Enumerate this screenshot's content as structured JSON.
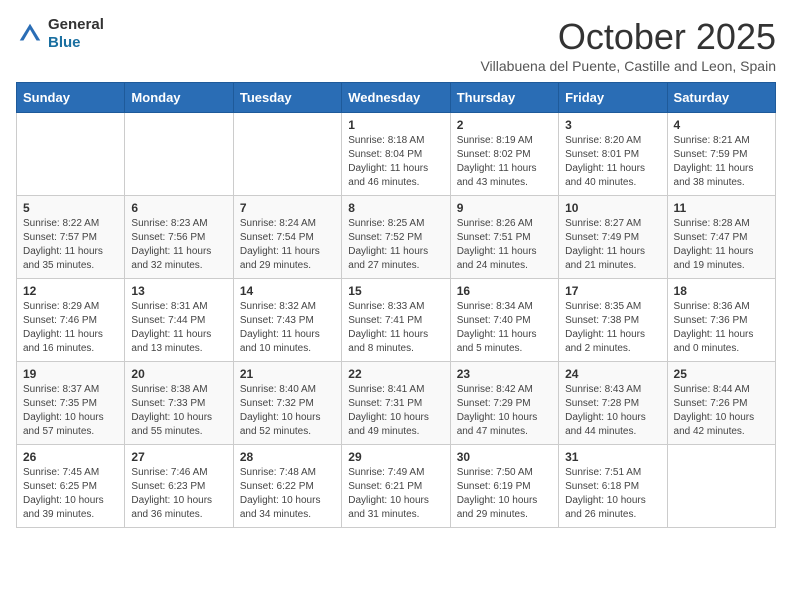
{
  "header": {
    "logo_general": "General",
    "logo_blue": "Blue",
    "month_title": "October 2025",
    "subtitle": "Villabuena del Puente, Castille and Leon, Spain"
  },
  "weekdays": [
    "Sunday",
    "Monday",
    "Tuesday",
    "Wednesday",
    "Thursday",
    "Friday",
    "Saturday"
  ],
  "weeks": [
    [
      {
        "day": "",
        "sunrise": "",
        "sunset": "",
        "daylight": ""
      },
      {
        "day": "",
        "sunrise": "",
        "sunset": "",
        "daylight": ""
      },
      {
        "day": "",
        "sunrise": "",
        "sunset": "",
        "daylight": ""
      },
      {
        "day": "1",
        "sunrise": "Sunrise: 8:18 AM",
        "sunset": "Sunset: 8:04 PM",
        "daylight": "Daylight: 11 hours and 46 minutes."
      },
      {
        "day": "2",
        "sunrise": "Sunrise: 8:19 AM",
        "sunset": "Sunset: 8:02 PM",
        "daylight": "Daylight: 11 hours and 43 minutes."
      },
      {
        "day": "3",
        "sunrise": "Sunrise: 8:20 AM",
        "sunset": "Sunset: 8:01 PM",
        "daylight": "Daylight: 11 hours and 40 minutes."
      },
      {
        "day": "4",
        "sunrise": "Sunrise: 8:21 AM",
        "sunset": "Sunset: 7:59 PM",
        "daylight": "Daylight: 11 hours and 38 minutes."
      }
    ],
    [
      {
        "day": "5",
        "sunrise": "Sunrise: 8:22 AM",
        "sunset": "Sunset: 7:57 PM",
        "daylight": "Daylight: 11 hours and 35 minutes."
      },
      {
        "day": "6",
        "sunrise": "Sunrise: 8:23 AM",
        "sunset": "Sunset: 7:56 PM",
        "daylight": "Daylight: 11 hours and 32 minutes."
      },
      {
        "day": "7",
        "sunrise": "Sunrise: 8:24 AM",
        "sunset": "Sunset: 7:54 PM",
        "daylight": "Daylight: 11 hours and 29 minutes."
      },
      {
        "day": "8",
        "sunrise": "Sunrise: 8:25 AM",
        "sunset": "Sunset: 7:52 PM",
        "daylight": "Daylight: 11 hours and 27 minutes."
      },
      {
        "day": "9",
        "sunrise": "Sunrise: 8:26 AM",
        "sunset": "Sunset: 7:51 PM",
        "daylight": "Daylight: 11 hours and 24 minutes."
      },
      {
        "day": "10",
        "sunrise": "Sunrise: 8:27 AM",
        "sunset": "Sunset: 7:49 PM",
        "daylight": "Daylight: 11 hours and 21 minutes."
      },
      {
        "day": "11",
        "sunrise": "Sunrise: 8:28 AM",
        "sunset": "Sunset: 7:47 PM",
        "daylight": "Daylight: 11 hours and 19 minutes."
      }
    ],
    [
      {
        "day": "12",
        "sunrise": "Sunrise: 8:29 AM",
        "sunset": "Sunset: 7:46 PM",
        "daylight": "Daylight: 11 hours and 16 minutes."
      },
      {
        "day": "13",
        "sunrise": "Sunrise: 8:31 AM",
        "sunset": "Sunset: 7:44 PM",
        "daylight": "Daylight: 11 hours and 13 minutes."
      },
      {
        "day": "14",
        "sunrise": "Sunrise: 8:32 AM",
        "sunset": "Sunset: 7:43 PM",
        "daylight": "Daylight: 11 hours and 10 minutes."
      },
      {
        "day": "15",
        "sunrise": "Sunrise: 8:33 AM",
        "sunset": "Sunset: 7:41 PM",
        "daylight": "Daylight: 11 hours and 8 minutes."
      },
      {
        "day": "16",
        "sunrise": "Sunrise: 8:34 AM",
        "sunset": "Sunset: 7:40 PM",
        "daylight": "Daylight: 11 hours and 5 minutes."
      },
      {
        "day": "17",
        "sunrise": "Sunrise: 8:35 AM",
        "sunset": "Sunset: 7:38 PM",
        "daylight": "Daylight: 11 hours and 2 minutes."
      },
      {
        "day": "18",
        "sunrise": "Sunrise: 8:36 AM",
        "sunset": "Sunset: 7:36 PM",
        "daylight": "Daylight: 11 hours and 0 minutes."
      }
    ],
    [
      {
        "day": "19",
        "sunrise": "Sunrise: 8:37 AM",
        "sunset": "Sunset: 7:35 PM",
        "daylight": "Daylight: 10 hours and 57 minutes."
      },
      {
        "day": "20",
        "sunrise": "Sunrise: 8:38 AM",
        "sunset": "Sunset: 7:33 PM",
        "daylight": "Daylight: 10 hours and 55 minutes."
      },
      {
        "day": "21",
        "sunrise": "Sunrise: 8:40 AM",
        "sunset": "Sunset: 7:32 PM",
        "daylight": "Daylight: 10 hours and 52 minutes."
      },
      {
        "day": "22",
        "sunrise": "Sunrise: 8:41 AM",
        "sunset": "Sunset: 7:31 PM",
        "daylight": "Daylight: 10 hours and 49 minutes."
      },
      {
        "day": "23",
        "sunrise": "Sunrise: 8:42 AM",
        "sunset": "Sunset: 7:29 PM",
        "daylight": "Daylight: 10 hours and 47 minutes."
      },
      {
        "day": "24",
        "sunrise": "Sunrise: 8:43 AM",
        "sunset": "Sunset: 7:28 PM",
        "daylight": "Daylight: 10 hours and 44 minutes."
      },
      {
        "day": "25",
        "sunrise": "Sunrise: 8:44 AM",
        "sunset": "Sunset: 7:26 PM",
        "daylight": "Daylight: 10 hours and 42 minutes."
      }
    ],
    [
      {
        "day": "26",
        "sunrise": "Sunrise: 7:45 AM",
        "sunset": "Sunset: 6:25 PM",
        "daylight": "Daylight: 10 hours and 39 minutes."
      },
      {
        "day": "27",
        "sunrise": "Sunrise: 7:46 AM",
        "sunset": "Sunset: 6:23 PM",
        "daylight": "Daylight: 10 hours and 36 minutes."
      },
      {
        "day": "28",
        "sunrise": "Sunrise: 7:48 AM",
        "sunset": "Sunset: 6:22 PM",
        "daylight": "Daylight: 10 hours and 34 minutes."
      },
      {
        "day": "29",
        "sunrise": "Sunrise: 7:49 AM",
        "sunset": "Sunset: 6:21 PM",
        "daylight": "Daylight: 10 hours and 31 minutes."
      },
      {
        "day": "30",
        "sunrise": "Sunrise: 7:50 AM",
        "sunset": "Sunset: 6:19 PM",
        "daylight": "Daylight: 10 hours and 29 minutes."
      },
      {
        "day": "31",
        "sunrise": "Sunrise: 7:51 AM",
        "sunset": "Sunset: 6:18 PM",
        "daylight": "Daylight: 10 hours and 26 minutes."
      },
      {
        "day": "",
        "sunrise": "",
        "sunset": "",
        "daylight": ""
      }
    ]
  ]
}
